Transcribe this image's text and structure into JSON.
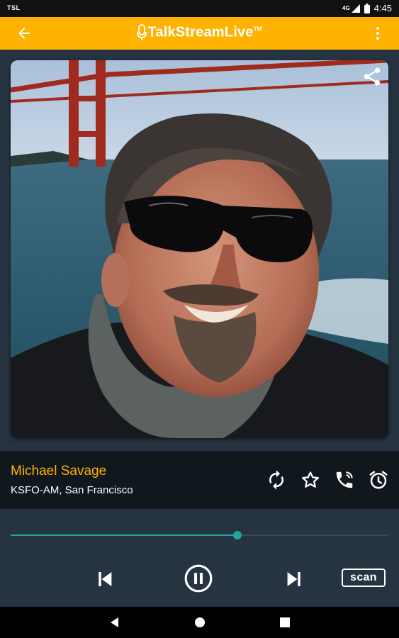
{
  "status_bar": {
    "carrier": "TSL",
    "network": "4G",
    "time": "4:45"
  },
  "app_bar": {
    "logo_text": "TalkStreamLive",
    "logo_trademark": "TM"
  },
  "now_playing": {
    "host": "Michael Savage",
    "station": "KSFO-AM, San Francisco"
  },
  "player": {
    "progress_percent": 60,
    "scan_label": "scan"
  },
  "colors": {
    "accent": "#FFB300",
    "progress": "#1ea89a",
    "background": "#263340",
    "info_bar": "#10171d"
  },
  "icons": {
    "back": "arrow-left-icon",
    "more": "more-vert-icon",
    "share": "share-icon",
    "refresh": "refresh-icon",
    "favorite": "star-outline-icon",
    "call": "phone-call-icon",
    "alarm": "alarm-icon",
    "prev": "skip-previous-icon",
    "pause": "pause-circle-icon",
    "next": "skip-next-icon"
  }
}
